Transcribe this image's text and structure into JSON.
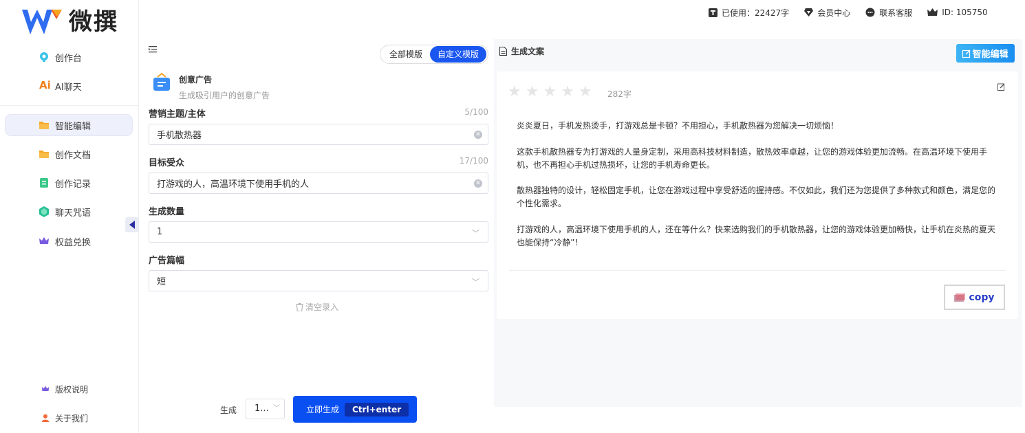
{
  "brand": {
    "name": "微撰"
  },
  "sidebar": {
    "items": [
      {
        "label": "创作台",
        "icon": "lightbulb-icon"
      },
      {
        "label": "AI聊天",
        "icon": "ai-icon"
      },
      {
        "label": "智能编辑",
        "icon": "folder-icon"
      },
      {
        "label": "创作文档",
        "icon": "folder-icon"
      },
      {
        "label": "创作记录",
        "icon": "record-icon"
      },
      {
        "label": "聊天咒语",
        "icon": "gem-icon"
      },
      {
        "label": "权益兑换",
        "icon": "crown-icon"
      }
    ],
    "ai_badge": "Ai",
    "footer": [
      {
        "label": "版权说明",
        "icon": "crown-icon"
      },
      {
        "label": "关于我们",
        "icon": "user-icon"
      }
    ]
  },
  "topbar": {
    "used": "已使用：22427字",
    "vip": "会员中心",
    "support": "联系客服",
    "id": "ID: 105750"
  },
  "tabs": {
    "all": "全部模版",
    "custom": "自定义模版"
  },
  "template": {
    "title": "创意广告",
    "subtitle": "生成吸引用户的创意广告"
  },
  "form": {
    "topic": {
      "label": "营销主题/主体",
      "count": "5/100",
      "value": "手机散热器"
    },
    "audience": {
      "label": "目标受众",
      "count": "17/100",
      "value": "打游戏的人，高温环境下使用手机的人"
    },
    "quantity": {
      "label": "生成数量",
      "value": "1"
    },
    "length": {
      "label": "广告篇幅",
      "value": "短"
    },
    "clear": "清空录入"
  },
  "generate": {
    "label": "生成",
    "select": "1...",
    "button": "立即生成",
    "shortcut": "Ctrl+enter"
  },
  "result": {
    "title": "生成文案",
    "smart_edit": "智能编辑",
    "rating": 0,
    "word_count": "282字",
    "paragraphs": [
      "炎炎夏日，手机发热烫手，打游戏总是卡顿？不用担心，手机散热器为您解决一切烦恼！",
      "这款手机散热器专为打游戏的人量身定制，采用高科技材料制造，散热效率卓越，让您的游戏体验更加流畅。在高温环境下使用手机，也不再担心手机过热损坏，让您的手机寿命更长。",
      "散热器独特的设计，轻松固定手机，让您在游戏过程中享受舒适的握持感。不仅如此，我们还为您提供了多种款式和颜色，满足您的个性化需求。",
      "打游戏的人，高温环境下使用手机的人，还在等什么？快来选购我们的手机散热器，让您的游戏体验更加畅快，让手机在炎热的夏天也能保持“冷静”！"
    ],
    "copy": "copy"
  },
  "colors": {
    "primary": "#0a4ff2",
    "accent": "#1a8ef0"
  }
}
